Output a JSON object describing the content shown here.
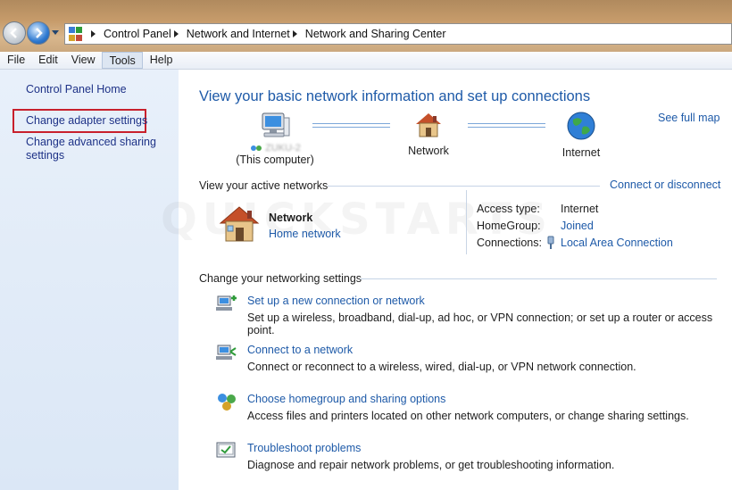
{
  "breadcrumb": [
    "Control Panel",
    "Network and Internet",
    "Network and Sharing Center"
  ],
  "menu": [
    "File",
    "Edit",
    "View",
    "Tools",
    "Help"
  ],
  "menu_active": "Tools",
  "sidebar": {
    "items": [
      {
        "label": "Control Panel Home"
      },
      {
        "label": "Change adapter settings"
      },
      {
        "label": "Change advanced sharing settings"
      }
    ]
  },
  "main": {
    "heading": "View your basic network information and set up connections",
    "see_full_map": "See full map",
    "map": {
      "computer_name": "ZUKU-2",
      "computer_caption": "(This computer)",
      "network": "Network",
      "internet": "Internet"
    },
    "active_networks": {
      "label": "View your active networks",
      "connect_link": "Connect or disconnect",
      "network_name": "Network",
      "network_type": "Home network",
      "access_type_label": "Access type:",
      "access_type_value": "Internet",
      "homegroup_label": "HomeGroup:",
      "homegroup_value": "Joined",
      "connections_label": "Connections:",
      "connections_value": "Local Area Connection"
    },
    "settings": {
      "label": "Change your networking settings",
      "tasks": [
        {
          "title": "Set up a new connection or network",
          "desc": "Set up a wireless, broadband, dial-up, ad hoc, or VPN connection; or set up a router or access point."
        },
        {
          "title": "Connect to a network",
          "desc": "Connect or reconnect to a wireless, wired, dial-up, or VPN network connection."
        },
        {
          "title": "Choose homegroup and sharing options",
          "desc": "Access files and printers located on other network computers, or change sharing settings."
        },
        {
          "title": "Troubleshoot problems",
          "desc": "Diagnose and repair network problems, or get troubleshooting information."
        }
      ]
    }
  },
  "watermark": "QUICKSTARTS",
  "colors": {
    "link": "#1e5aa8",
    "highlight": "#c8202c",
    "sidebar": "#e2ecf8"
  }
}
